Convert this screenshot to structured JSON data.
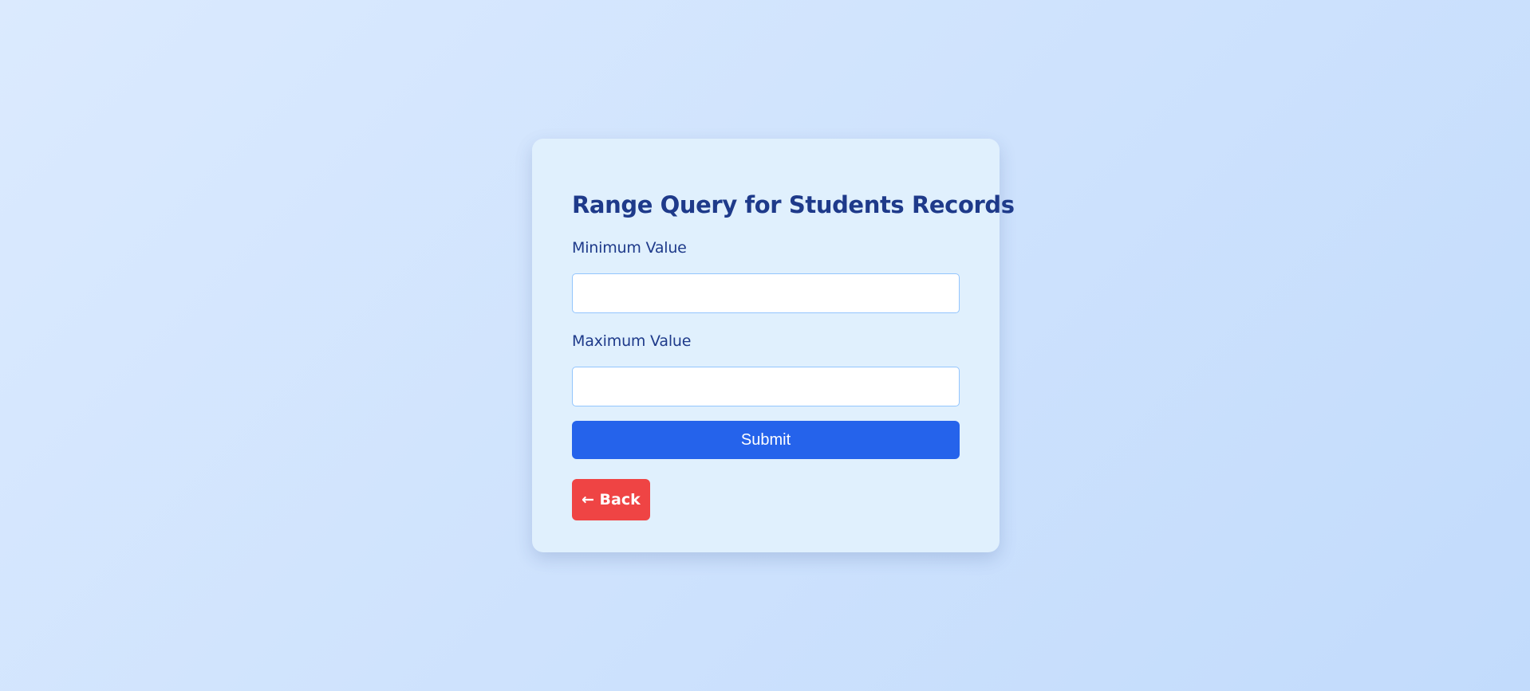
{
  "form": {
    "title": "Range Query for Students Records",
    "min_label": "Minimum Value",
    "min_value": "",
    "max_label": "Maximum Value",
    "max_value": "",
    "submit_label": "Submit",
    "back_label": "← Back"
  },
  "colors": {
    "background_start": "#dbeafe",
    "background_end": "#c2dbfc",
    "card": "#e0f0fd",
    "title_text": "#1e3a8a",
    "input_border": "#93c5fd",
    "submit_button": "#2563eb",
    "back_button": "#ef4444"
  },
  "icons": {
    "back": "left-arrow-icon"
  }
}
